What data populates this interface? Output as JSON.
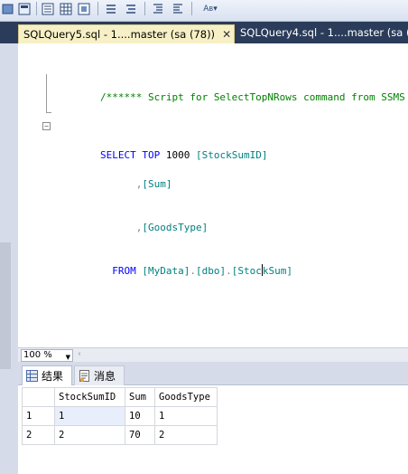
{
  "toolbar": {
    "icons": [
      "toolbar-icon-a",
      "toolbar-icon-b",
      "toolbar-icon-c",
      "toolbar-icon-d",
      "toolbar-icon-e",
      "toolbar-icon-f",
      "toolbar-icon-g",
      "toolbar-icon-h",
      "toolbar-icon-i"
    ]
  },
  "tabs": [
    {
      "label": "SQLQuery5.sql - 1....master (sa (78))",
      "close": "✕",
      "active": true
    },
    {
      "label": "SQLQuery4.sql - 1....master (sa (",
      "active": false
    }
  ],
  "editor": {
    "lines": [
      {
        "comment": "/****** Script for SelectTopNRows command from SSMS  ****"
      },
      {
        "kw1": "SELECT",
        "kw2": "TOP",
        "num": "1000",
        "col": "[StockSumID]"
      },
      {
        "comma": ",",
        "col": "[Sum]"
      },
      {
        "comma": ",",
        "col": "[GoodsType]"
      },
      {
        "kw": "FROM",
        "table_a": "[MyData]",
        "dot1": ".",
        "table_b": "[dbo]",
        "dot2": ".",
        "table_c1": "[Stoc",
        "table_c2": "kSum]"
      }
    ]
  },
  "zoom": {
    "value": "100 %",
    "arrow": "▼",
    "left": "‹"
  },
  "results": {
    "tabs": [
      {
        "label": "结果",
        "active": true
      },
      {
        "label": "消息",
        "active": false
      }
    ],
    "columns": [
      "",
      "StockSumID",
      "Sum",
      "GoodsType"
    ],
    "rows": [
      [
        "1",
        "1",
        "10",
        "1"
      ],
      [
        "2",
        "2",
        "70",
        "2"
      ]
    ]
  },
  "colors": {
    "tab_active_bg": "#f7f0c6",
    "tabstrip_bg": "#2b3c5a",
    "keyword": "#0000ff",
    "comment": "#008000",
    "identifier": "#008080"
  }
}
